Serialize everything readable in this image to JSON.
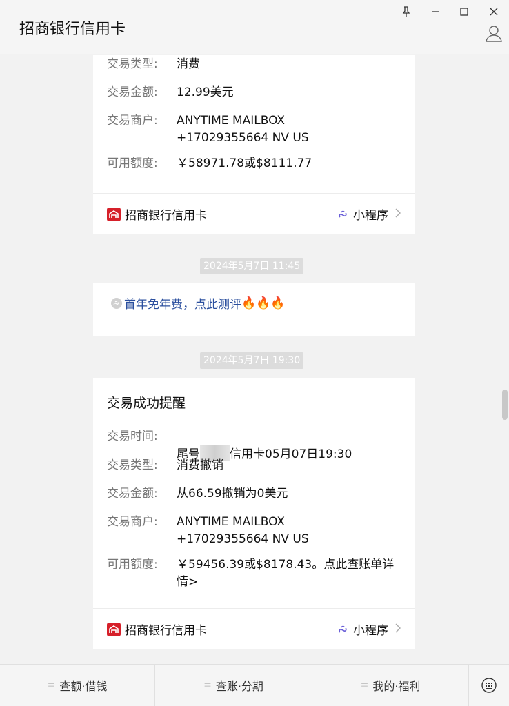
{
  "window": {
    "title": "招商银行信用卡",
    "buttons": {
      "pin": "pin-icon",
      "minimize": "minimize-icon",
      "maximize": "maximize-icon",
      "close": "close-icon"
    }
  },
  "card1": {
    "rows": [
      {
        "label": "交易类型:",
        "value": "消费"
      },
      {
        "label": "交易金额:",
        "value": "12.99美元"
      },
      {
        "label": "交易商户:",
        "value": "ANYTIME MAILBOX\n+17029355664 NV US"
      },
      {
        "label": "可用额度:",
        "value": "￥58971.78或$8111.77"
      }
    ],
    "footer": {
      "name": "招商银行信用卡",
      "mini_label": "小程序"
    }
  },
  "timestamp1": "2024年5月7日 11:45",
  "promo": {
    "text": "首年免年费，点此测评",
    "emoji": "🔥🔥🔥"
  },
  "timestamp2": "2024年5月7日 19:30",
  "card2": {
    "title": "交易成功提醒",
    "rows": [
      {
        "label": "交易时间:",
        "value_prefix": "尾号",
        "value_suffix": "信用卡05月07日19:30"
      },
      {
        "label": "交易类型:",
        "value": "消费撤销"
      },
      {
        "label": "交易金额:",
        "value": "从66.59撤销为0美元"
      },
      {
        "label": "交易商户:",
        "value": "ANYTIME MAILBOX\n+17029355664 NV US"
      },
      {
        "label": "可用额度:",
        "value": "￥59456.39或$8178.43。点此查账单详\n情>"
      }
    ],
    "footer": {
      "name": "招商银行信用卡",
      "mini_label": "小程序"
    }
  },
  "menu": [
    {
      "label": "查额·借钱"
    },
    {
      "label": "查账·分期"
    },
    {
      "label": "我的·福利"
    }
  ],
  "colors": {
    "brand_red": "#d6202a",
    "link_blue": "#2b4f9e",
    "mini_icon": "#6a5fd8"
  }
}
